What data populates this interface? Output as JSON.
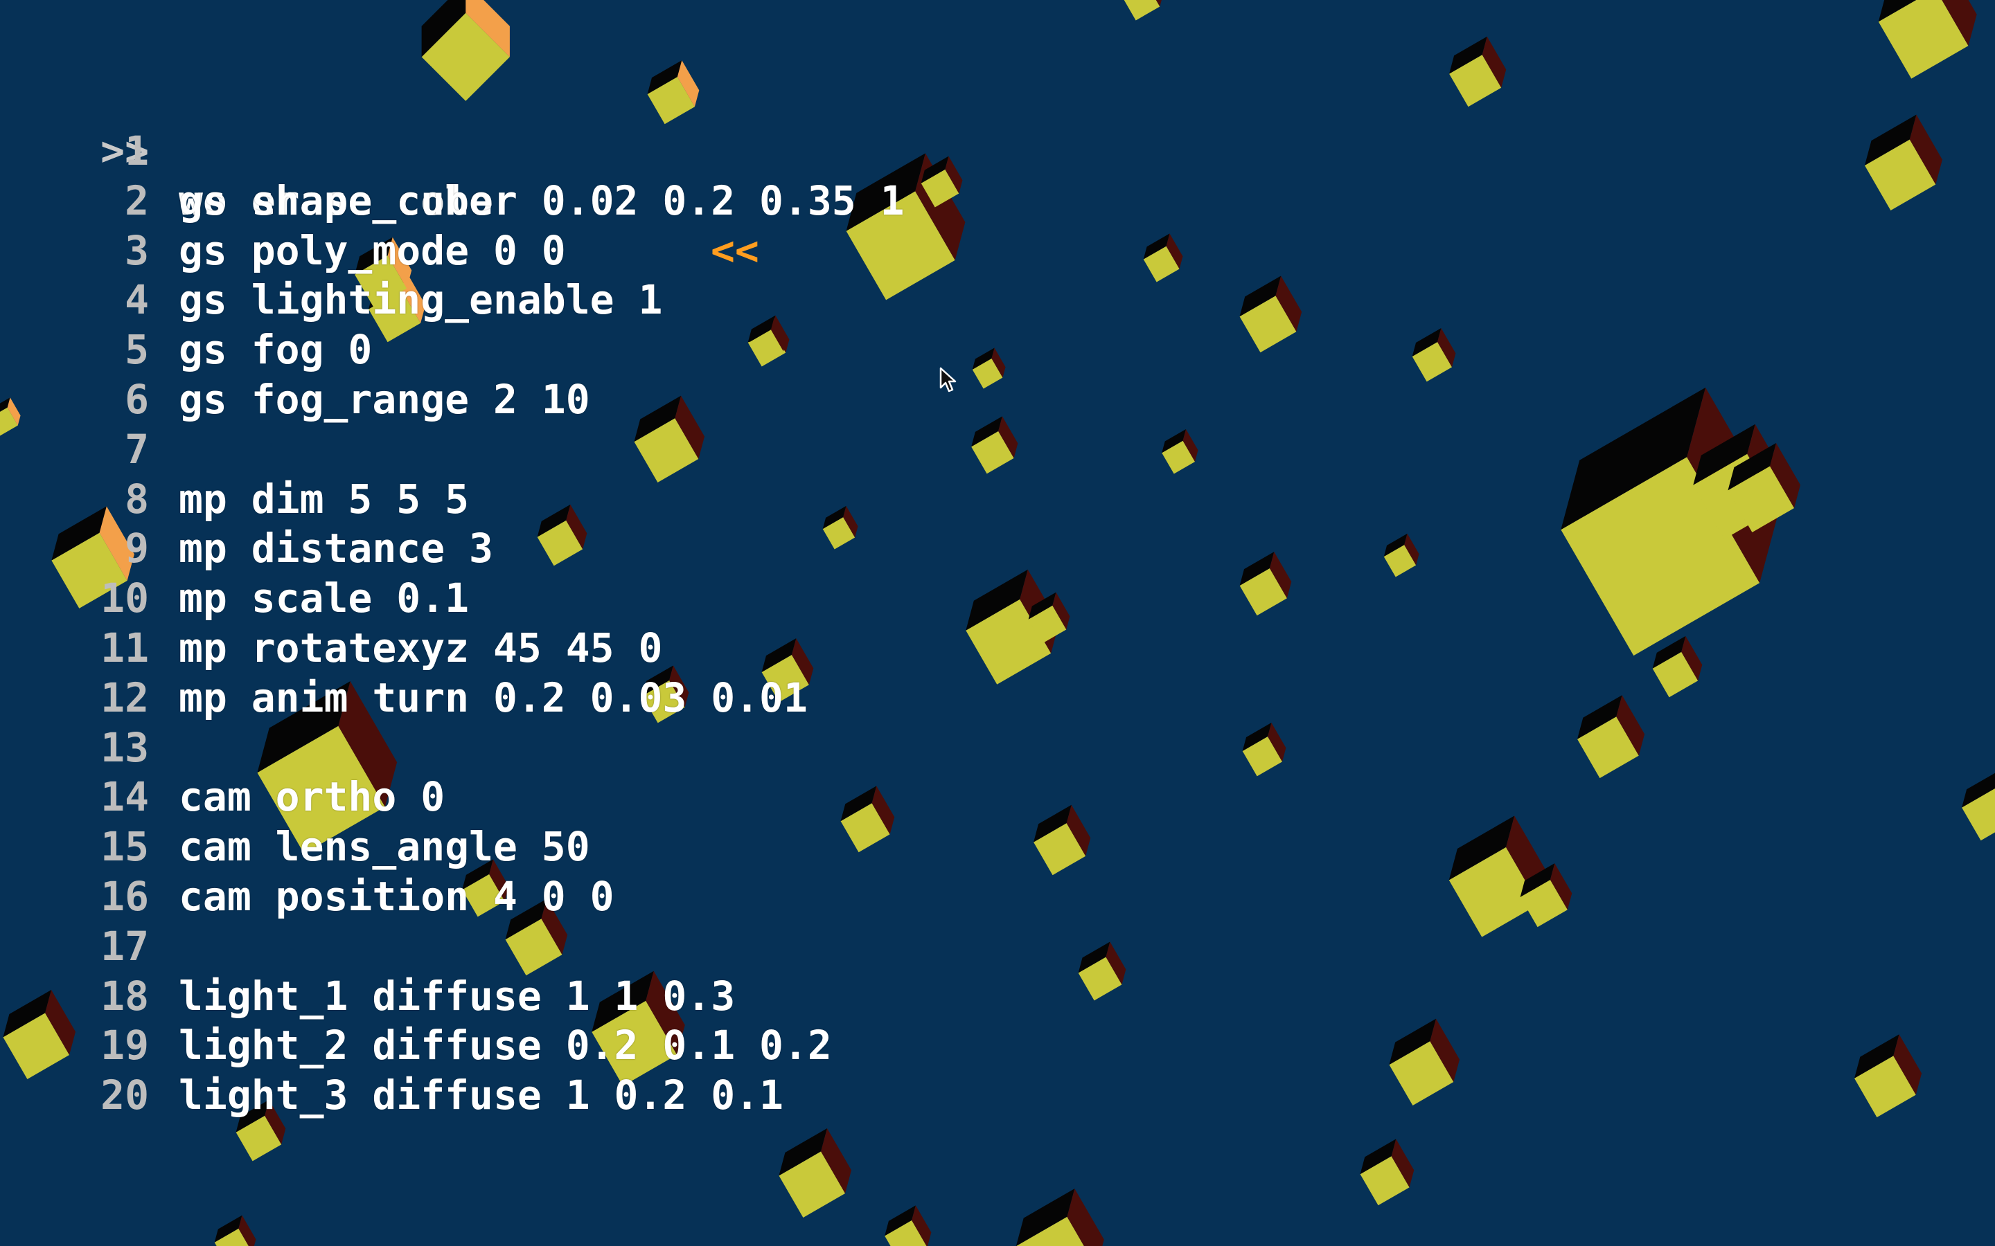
{
  "scene": {
    "background_color": "#063156",
    "cube_colors": {
      "face": "#c9c93a",
      "top": "#050505",
      "side": "#4a0e0a",
      "highlight": "#f3a04a"
    }
  },
  "console": {
    "prompt": {
      "marker": ">>",
      "text": "wo erase_color 0.02 0.2 0.35 1",
      "cursor_marker": "<<"
    },
    "lines": [
      {
        "n": "1",
        "text": ""
      },
      {
        "n": "2",
        "text": "gs shape cube"
      },
      {
        "n": "3",
        "text": "gs poly_mode 0 0"
      },
      {
        "n": "4",
        "text": "gs lighting_enable 1"
      },
      {
        "n": "5",
        "text": "gs fog 0"
      },
      {
        "n": "6",
        "text": "gs fog_range 2 10"
      },
      {
        "n": "7",
        "text": ""
      },
      {
        "n": "8",
        "text": "mp dim 5 5 5"
      },
      {
        "n": "9",
        "text": "mp distance 3"
      },
      {
        "n": "10",
        "text": "mp scale 0.1"
      },
      {
        "n": "11",
        "text": "mp rotatexyz 45 45 0"
      },
      {
        "n": "12",
        "text": "mp anim turn 0.2 0.03 0.01"
      },
      {
        "n": "13",
        "text": ""
      },
      {
        "n": "14",
        "text": "cam ortho 0"
      },
      {
        "n": "15",
        "text": "cam lens_angle 50"
      },
      {
        "n": "16",
        "text": "cam position 4 0 0"
      },
      {
        "n": "17",
        "text": ""
      },
      {
        "n": "18",
        "text": "light_1 diffuse 1 1 0.3"
      },
      {
        "n": "19",
        "text": "light_2 diffuse 0.2 0.1 0.2"
      },
      {
        "n": "20",
        "text": "light_3 diffuse 1 0.2 0.1"
      }
    ]
  },
  "icons": {
    "mouse": "arrow-cursor-icon"
  }
}
